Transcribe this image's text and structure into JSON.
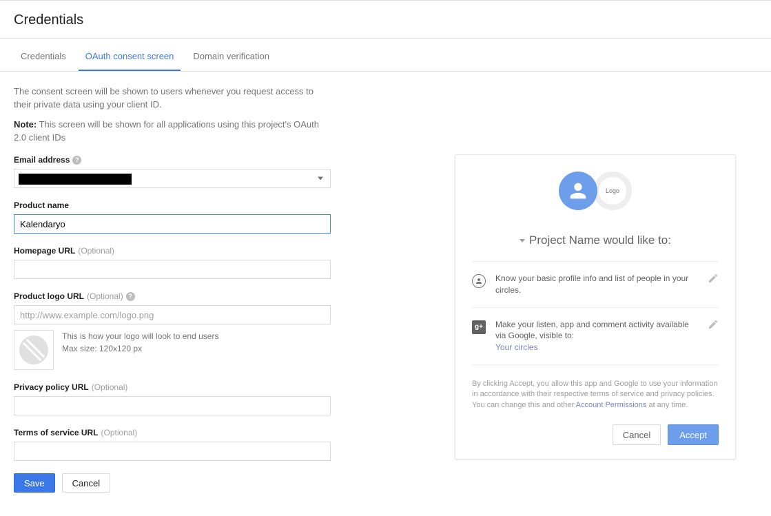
{
  "page_title": "Credentials",
  "tabs": [
    {
      "label": "Credentials",
      "active": false
    },
    {
      "label": "OAuth consent screen",
      "active": true
    },
    {
      "label": "Domain verification",
      "active": false
    }
  ],
  "description": "The consent screen will be shown to users whenever you request access to their private data using your client ID.",
  "note_prefix": "Note:",
  "note_text": " This screen will be shown for all applications using this project's OAuth 2.0 client IDs",
  "fields": {
    "email": {
      "label": "Email address",
      "value": ""
    },
    "product_name": {
      "label": "Product name",
      "value": "Kalendaryo"
    },
    "homepage": {
      "label": "Homepage URL",
      "optional": "(Optional)",
      "value": ""
    },
    "logo_url": {
      "label": "Product logo URL",
      "optional": "(Optional)",
      "placeholder": "http://www.example.com/logo.png"
    },
    "logo_hint1": "This is how your logo will look to end users",
    "logo_hint2": "Max size: 120x120 px",
    "privacy": {
      "label": "Privacy policy URL",
      "optional": "(Optional)",
      "value": ""
    },
    "tos": {
      "label": "Terms of service URL",
      "optional": "(Optional)",
      "value": ""
    }
  },
  "buttons": {
    "save": "Save",
    "cancel": "Cancel"
  },
  "preview": {
    "logo_text": "Logo",
    "title": "Project Name would like to:",
    "perms": [
      {
        "text": "Know your basic profile info and list of people in your circles."
      },
      {
        "text": "Make your listen, app and comment activity available via Google, visible to:",
        "link": "Your circles"
      }
    ],
    "disclaimer_1": "By clicking Accept, you allow this app and Google to use your information in accordance with their respective terms of service and privacy policies. You can change this and other ",
    "disclaimer_link": "Account Permissions",
    "disclaimer_2": " at any time.",
    "cancel": "Cancel",
    "accept": "Accept"
  }
}
